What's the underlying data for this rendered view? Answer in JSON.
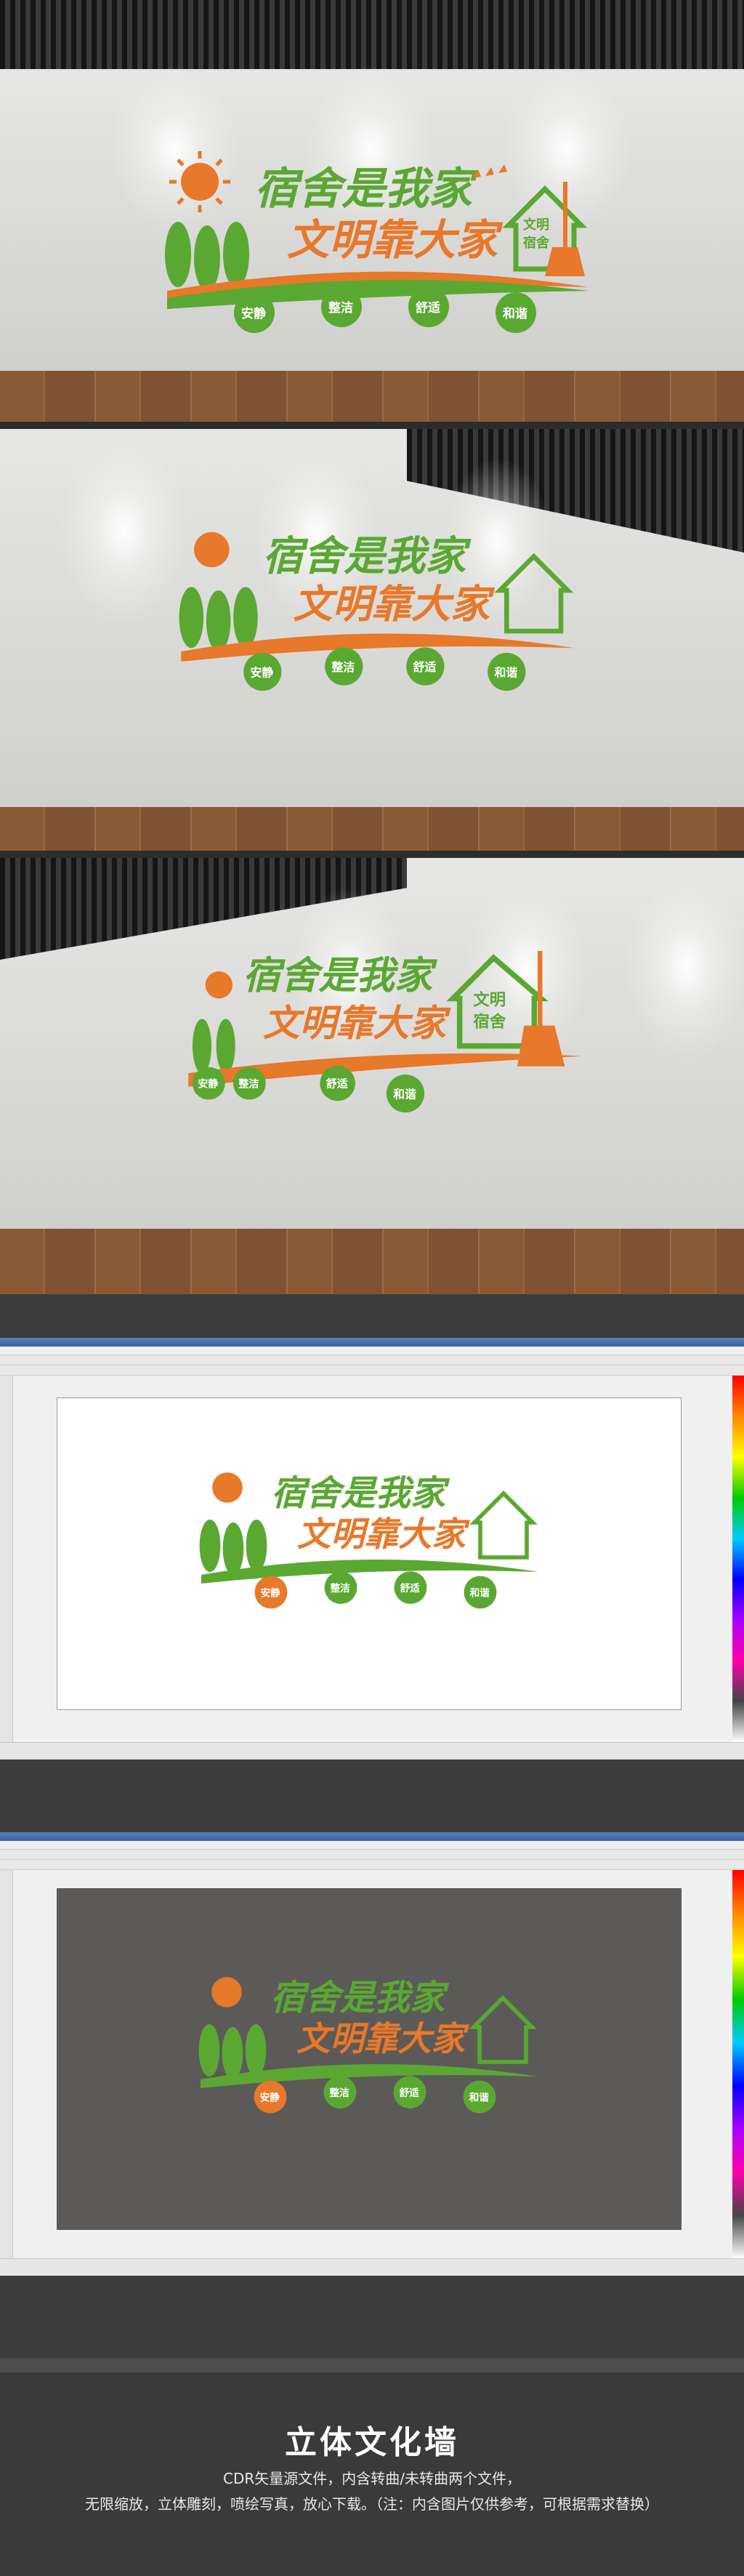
{
  "sign": {
    "line1": "宿舍是我家",
    "line2": "文明靠大家",
    "house_label_1": "文明",
    "house_label_2": "宿舍",
    "badges": [
      "安静",
      "整洁",
      "舒适",
      "和谐"
    ]
  },
  "colors": {
    "green": "#5aa832",
    "orange": "#e8782a",
    "wall": "#d7d7d5",
    "editor_dark_canvas": "#5c5a58"
  },
  "footer": {
    "title": "立体文化墙",
    "line1": "CDR矢量源文件，内含转曲/未转曲两个文件，",
    "line2": "无限缩放，立体雕刻，喷绘写真，放心下载。（注：内含图片仅供参考，可根据需求替换）"
  },
  "icons": [
    "sun-icon",
    "tree-icon",
    "bird-icon",
    "house-icon",
    "broom-icon"
  ]
}
